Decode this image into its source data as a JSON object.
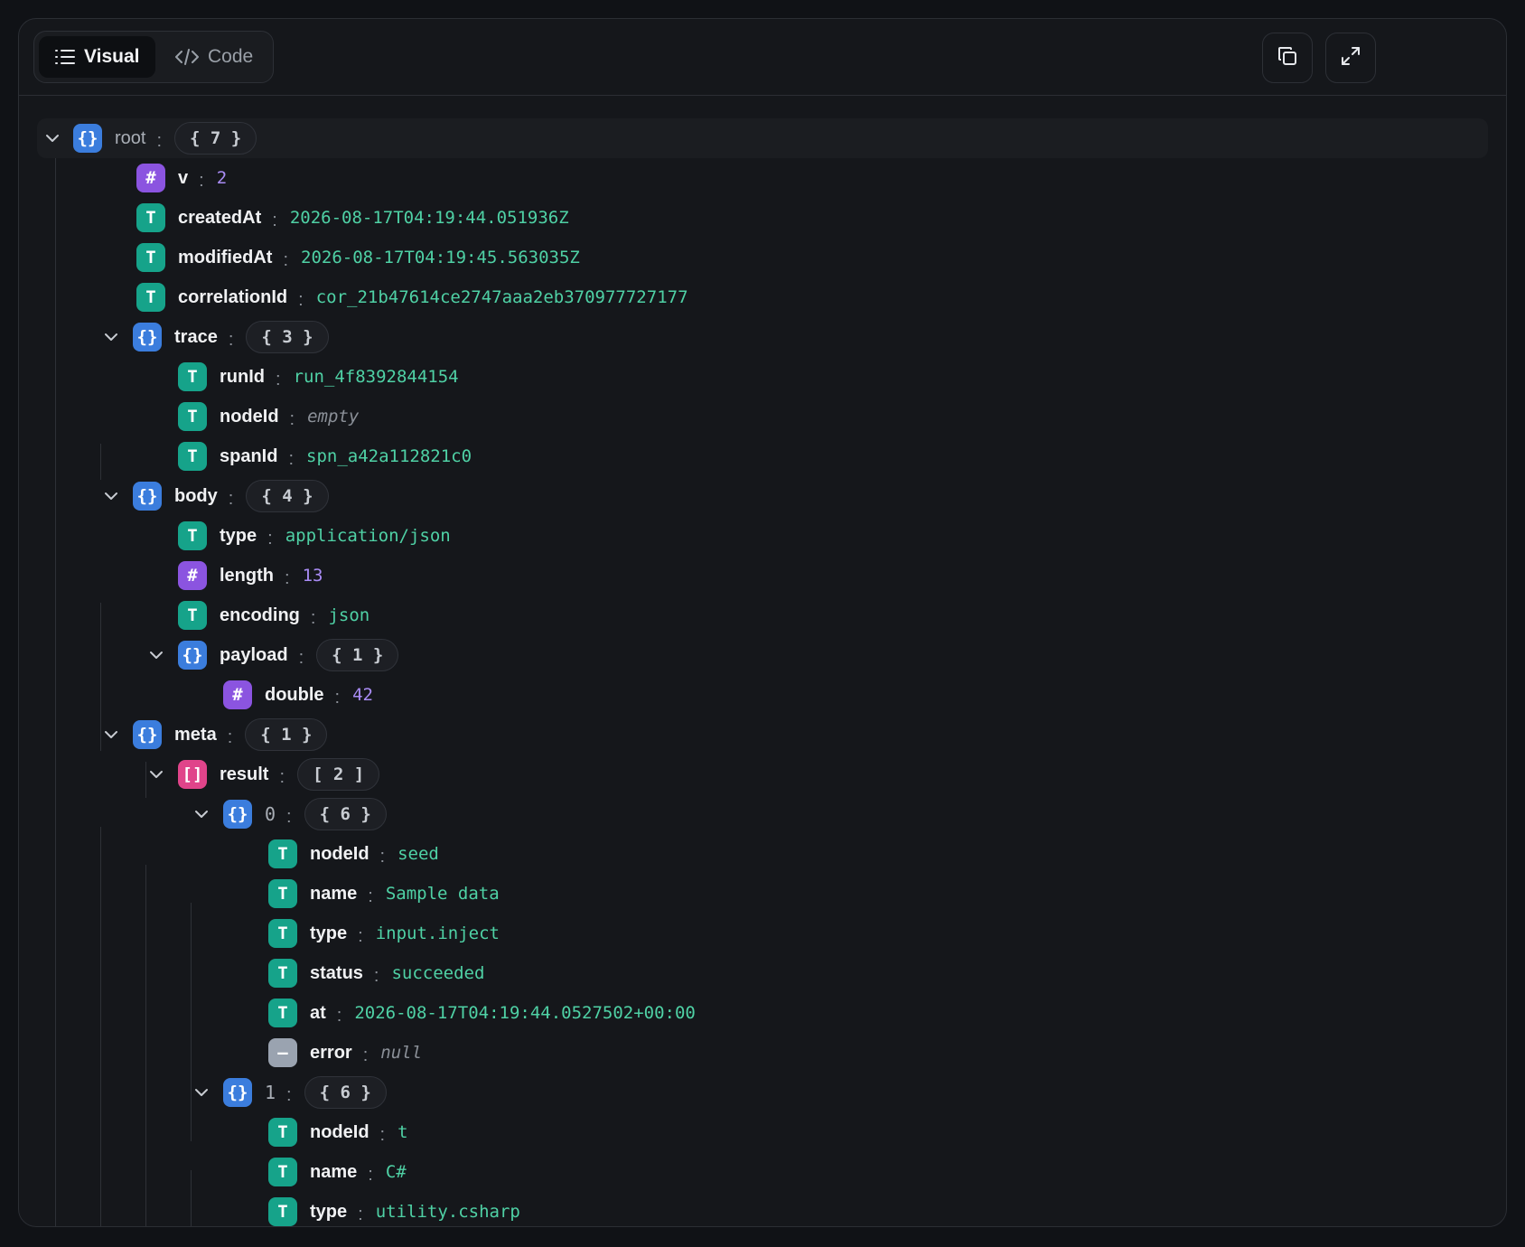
{
  "tabs": {
    "visual_label": "Visual",
    "code_label": "Code"
  },
  "header_icons": {
    "copy": "copy-icon",
    "expand": "expand-icon"
  },
  "colors": {
    "object": "#3b7ddd",
    "string": "#16a38a",
    "number": "#8b54e0",
    "array": "#e0448a",
    "null": "#9aa3b0",
    "string_value": "#4fd1a5",
    "number_value": "#a98cf5"
  },
  "tree": {
    "root": {
      "key": "root",
      "count": "{ 7 }"
    },
    "v": {
      "key": "v",
      "value": "2"
    },
    "createdAt": {
      "key": "createdAt",
      "value": "2026-08-17T04:19:44.051936Z"
    },
    "modifiedAt": {
      "key": "modifiedAt",
      "value": "2026-08-17T04:19:45.563035Z"
    },
    "correlationId": {
      "key": "correlationId",
      "value": "cor_21b47614ce2747aaa2eb370977727177"
    },
    "trace": {
      "key": "trace",
      "count": "{ 3 }",
      "runId": {
        "key": "runId",
        "value": "run_4f8392844154"
      },
      "nodeId": {
        "key": "nodeId",
        "value": "empty"
      },
      "spanId": {
        "key": "spanId",
        "value": "spn_a42a112821c0"
      }
    },
    "body": {
      "key": "body",
      "count": "{ 4 }",
      "type": {
        "key": "type",
        "value": "application/json"
      },
      "length": {
        "key": "length",
        "value": "13"
      },
      "encoding": {
        "key": "encoding",
        "value": "json"
      },
      "payload": {
        "key": "payload",
        "count": "{ 1 }",
        "double": {
          "key": "double",
          "value": "42"
        }
      }
    },
    "meta": {
      "key": "meta",
      "count": "{ 1 }",
      "result": {
        "key": "result",
        "count": "[ 2 ]",
        "item0": {
          "key": "0",
          "count": "{ 6 }",
          "nodeId": {
            "key": "nodeId",
            "value": "seed"
          },
          "name": {
            "key": "name",
            "value": "Sample data"
          },
          "type": {
            "key": "type",
            "value": "input.inject"
          },
          "status": {
            "key": "status",
            "value": "succeeded"
          },
          "at": {
            "key": "at",
            "value": "2026-08-17T04:19:44.0527502+00:00"
          },
          "error": {
            "key": "error",
            "value": "null"
          }
        },
        "item1": {
          "key": "1",
          "count": "{ 6 }",
          "nodeId": {
            "key": "nodeId",
            "value": "t"
          },
          "name": {
            "key": "name",
            "value": "C#"
          },
          "type": {
            "key": "type",
            "value": "utility.csharp"
          }
        }
      }
    }
  }
}
